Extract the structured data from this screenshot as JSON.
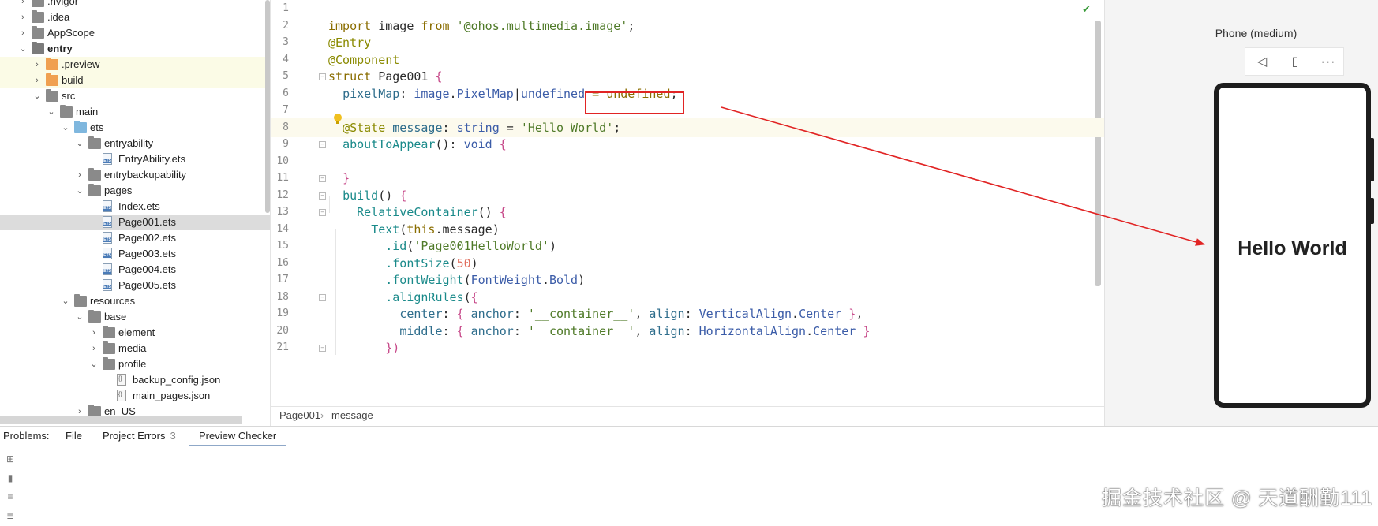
{
  "tree": {
    "items": [
      {
        "label": ".hvigor",
        "arrow": "›",
        "icon": "folder",
        "depth": 1
      },
      {
        "label": ".idea",
        "arrow": "›",
        "icon": "folder",
        "depth": 1
      },
      {
        "label": "AppScope",
        "arrow": "›",
        "icon": "folder",
        "depth": 1
      },
      {
        "label": "entry",
        "arrow": "⌄",
        "icon": "module-folder",
        "depth": 1,
        "bold": true
      },
      {
        "label": ".preview",
        "arrow": "›",
        "icon": "orange-folder",
        "depth": 2,
        "highlight": true
      },
      {
        "label": "build",
        "arrow": "›",
        "icon": "orange-folder",
        "depth": 2,
        "highlight": true
      },
      {
        "label": "src",
        "arrow": "⌄",
        "icon": "folder",
        "depth": 2
      },
      {
        "label": "main",
        "arrow": "⌄",
        "icon": "folder",
        "depth": 3
      },
      {
        "label": "ets",
        "arrow": "⌄",
        "icon": "blue-folder",
        "depth": 4
      },
      {
        "label": "entryability",
        "arrow": "⌄",
        "icon": "folder",
        "depth": 5
      },
      {
        "label": "EntryAbility.ets",
        "arrow": "",
        "icon": "ets-file",
        "depth": 6
      },
      {
        "label": "entrybackupability",
        "arrow": "›",
        "icon": "folder",
        "depth": 5
      },
      {
        "label": "pages",
        "arrow": "⌄",
        "icon": "folder",
        "depth": 5
      },
      {
        "label": "Index.ets",
        "arrow": "",
        "icon": "ets-file",
        "depth": 6
      },
      {
        "label": "Page001.ets",
        "arrow": "",
        "icon": "ets-file",
        "depth": 6,
        "selected": true
      },
      {
        "label": "Page002.ets",
        "arrow": "",
        "icon": "ets-file",
        "depth": 6
      },
      {
        "label": "Page003.ets",
        "arrow": "",
        "icon": "ets-file",
        "depth": 6
      },
      {
        "label": "Page004.ets",
        "arrow": "",
        "icon": "ets-file",
        "depth": 6
      },
      {
        "label": "Page005.ets",
        "arrow": "",
        "icon": "ets-file",
        "depth": 6
      },
      {
        "label": "resources",
        "arrow": "⌄",
        "icon": "folder",
        "depth": 4
      },
      {
        "label": "base",
        "arrow": "⌄",
        "icon": "folder",
        "depth": 5
      },
      {
        "label": "element",
        "arrow": "›",
        "icon": "folder",
        "depth": 6
      },
      {
        "label": "media",
        "arrow": "›",
        "icon": "folder",
        "depth": 6
      },
      {
        "label": "profile",
        "arrow": "⌄",
        "icon": "folder",
        "depth": 6
      },
      {
        "label": "backup_config.json",
        "arrow": "",
        "icon": "json-file",
        "depth": 7
      },
      {
        "label": "main_pages.json",
        "arrow": "",
        "icon": "json-file",
        "depth": 7
      },
      {
        "label": "en_US",
        "arrow": "›",
        "icon": "folder",
        "depth": 5
      }
    ]
  },
  "editor": {
    "line_numbers": [
      "1",
      "2",
      "3",
      "4",
      "5",
      "6",
      "7",
      "8",
      "9",
      "10",
      "11",
      "12",
      "13",
      "14",
      "15",
      "16",
      "17",
      "18",
      "19",
      "20",
      "21"
    ],
    "status_icon": "check-icon"
  },
  "breadcrumb": {
    "file": "Page001",
    "symbol": "message",
    "separator": "›"
  },
  "preview": {
    "device_name": "Phone (medium)",
    "screen_text": "Hello World",
    "toolbar": [
      "back-triangle-icon",
      "rotate-device-icon",
      "more-icon"
    ]
  },
  "bottom": {
    "tabs": [
      {
        "label": "Problems:"
      },
      {
        "label": "File"
      },
      {
        "label": "Project Errors",
        "count": "3"
      },
      {
        "label": "Preview Checker",
        "active": true
      }
    ]
  },
  "watermark": "掘金技术社区 @ 天道酬勤111",
  "colors": {
    "annotation": "#e12424",
    "selection": "#dcdcdc",
    "current_line": "#fcfaed"
  }
}
